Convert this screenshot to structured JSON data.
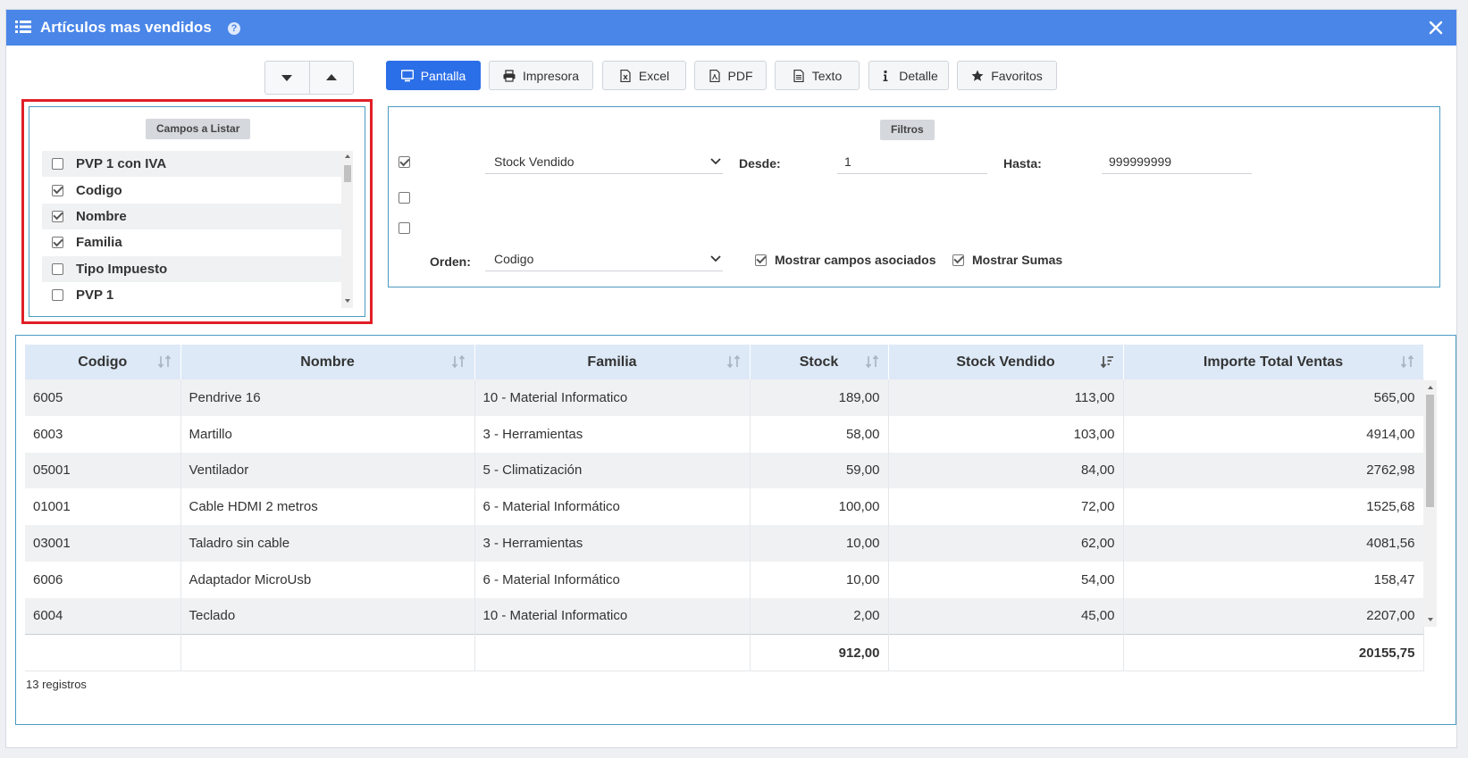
{
  "window": {
    "title": "Artículos mas vendidos",
    "help_glyph": "?"
  },
  "toolbar": {
    "buttons": [
      {
        "label": "Pantalla",
        "icon": "monitor-icon",
        "active": true
      },
      {
        "label": "Impresora",
        "icon": "printer-icon"
      },
      {
        "label": "Excel",
        "icon": "excel-icon"
      },
      {
        "label": "PDF",
        "icon": "pdf-icon"
      },
      {
        "label": "Texto",
        "icon": "text-file-icon"
      },
      {
        "label": "Detalle",
        "icon": "info-icon"
      },
      {
        "label": "Favoritos",
        "icon": "star-icon"
      }
    ]
  },
  "fields_panel": {
    "title": "Campos a Listar",
    "items": [
      {
        "label": "PVP 1 con IVA",
        "checked": false
      },
      {
        "label": "Codigo",
        "checked": true
      },
      {
        "label": "Nombre",
        "checked": true
      },
      {
        "label": "Familia",
        "checked": true
      },
      {
        "label": "Tipo Impuesto",
        "checked": false
      },
      {
        "label": "PVP 1",
        "checked": false
      }
    ]
  },
  "filters": {
    "title": "Filtros",
    "field_select": "Stock Vendido",
    "desde_label": "Desde:",
    "desde_value": "1",
    "hasta_label": "Hasta:",
    "hasta_value": "999999999",
    "orden_label": "Orden:",
    "orden_value": "Codigo",
    "mostrar_campos_label": "Mostrar campos asociados",
    "mostrar_sumas_label": "Mostrar Sumas"
  },
  "grid": {
    "columns": [
      "Codigo",
      "Nombre",
      "Familia",
      "Stock",
      "Stock Vendido",
      "Importe Total Ventas"
    ],
    "rows": [
      [
        "6005",
        "Pendrive 16",
        "10 - Material Informatico",
        "189,00",
        "113,00",
        "565,00"
      ],
      [
        "6003",
        "Martillo",
        "3 - Herramientas",
        "58,00",
        "103,00",
        "4914,00"
      ],
      [
        "05001",
        "Ventilador",
        "5 - Climatización",
        "59,00",
        "84,00",
        "2762,98"
      ],
      [
        "01001",
        "Cable HDMI 2 metros",
        "6 - Material Informático",
        "100,00",
        "72,00",
        "1525,68"
      ],
      [
        "03001",
        "Taladro sin cable",
        "3 - Herramientas",
        "10,00",
        "62,00",
        "4081,56"
      ],
      [
        "6006",
        "Adaptador MicroUsb",
        "6 - Material Informático",
        "10,00",
        "54,00",
        "158,47"
      ],
      [
        "6004",
        "Teclado",
        "10 - Material Informatico",
        "2,00",
        "45,00",
        "2207,00"
      ]
    ],
    "totals": [
      "",
      "",
      "",
      "912,00",
      "",
      "20155,75"
    ],
    "record_count": "13 registros"
  }
}
